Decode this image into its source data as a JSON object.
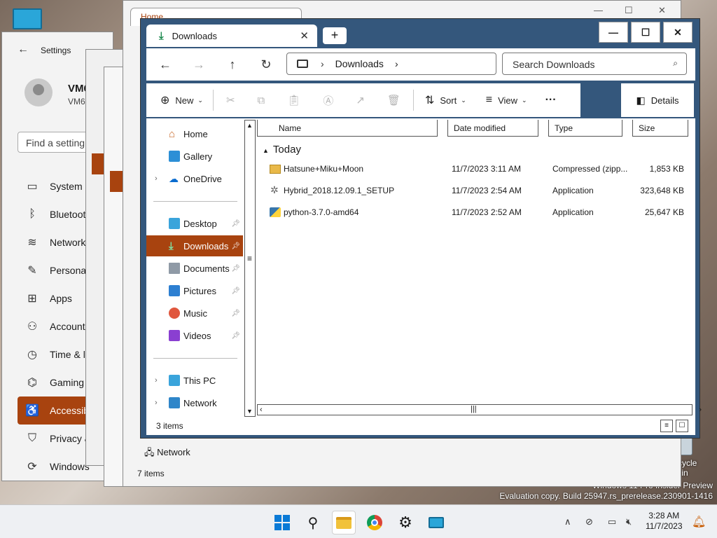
{
  "desktop": {
    "recycle_bin": "Recycle Bin",
    "watermark_line1": "Windows 11 Pro Insider Preview",
    "watermark_line2": "Evaluation copy. Build 25947.rs_prerelease.230901-1416"
  },
  "settings": {
    "title": "Settings",
    "user_name": "VM6",
    "user_sub": "VM6",
    "search_placeholder": "Find a setting",
    "nav": [
      {
        "label": "System",
        "icon": "monitor-icon"
      },
      {
        "label": "Bluetoot",
        "icon": "bluetooth-icon"
      },
      {
        "label": "Network",
        "icon": "wifi-icon"
      },
      {
        "label": "Personali",
        "icon": "brush-icon"
      },
      {
        "label": "Apps",
        "icon": "apps-icon"
      },
      {
        "label": "Accounts",
        "icon": "person-icon"
      },
      {
        "label": "Time & la",
        "icon": "clock-globe-icon"
      },
      {
        "label": "Gaming",
        "icon": "gamepad-icon"
      },
      {
        "label": "Accessib",
        "icon": "accessibility-icon",
        "active": true
      },
      {
        "label": "Privacy &",
        "icon": "shield-icon"
      },
      {
        "label": "Windows",
        "icon": "update-icon"
      }
    ]
  },
  "background_explorer": {
    "tab_title": "Home",
    "network_label": "Network",
    "status": "7 items"
  },
  "explorer": {
    "tab_title": "Downloads",
    "address_segment": "Downloads",
    "search_placeholder": "Search Downloads",
    "toolbar": {
      "new_label": "New",
      "sort_label": "Sort",
      "view_label": "View",
      "more_label": "···",
      "details_label": "Details"
    },
    "nav_pane": {
      "home": "Home",
      "gallery": "Gallery",
      "onedrive": "OneDrive",
      "desktop": "Desktop",
      "downloads": "Downloads",
      "documents": "Documents",
      "pictures": "Pictures",
      "music": "Music",
      "videos": "Videos",
      "this_pc": "This PC",
      "network": "Network"
    },
    "columns": {
      "name": "Name",
      "date_modified": "Date modified",
      "type": "Type",
      "size": "Size"
    },
    "group_label": "Today",
    "files": [
      {
        "name": "Hatsune+Miku+Moon",
        "date": "11/7/2023 3:11 AM",
        "type": "Compressed (zipp...",
        "size": "1,853 KB",
        "icon": "zip-folder-icon"
      },
      {
        "name": "Hybrid_2018.12.09.1_SETUP",
        "date": "11/7/2023 2:54 AM",
        "type": "Application",
        "size": "323,648 KB",
        "icon": "setup-app-icon"
      },
      {
        "name": "python-3.7.0-amd64",
        "date": "11/7/2023 2:52 AM",
        "type": "Application",
        "size": "25,647 KB",
        "icon": "installer-app-icon"
      }
    ],
    "status": "3 items"
  },
  "taskbar": {
    "time": "3:28 AM",
    "date": "11/7/2023"
  },
  "colors": {
    "accent": "#a8430f",
    "window_border": "#34577c"
  }
}
